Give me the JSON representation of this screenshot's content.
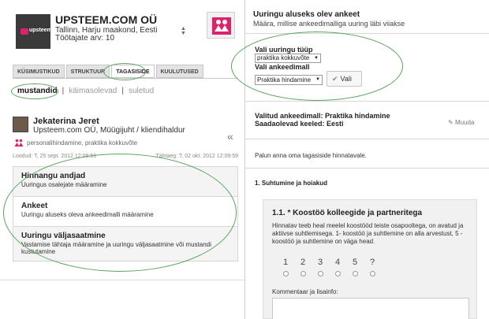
{
  "company": {
    "name": "UPSTEEM.COM OÜ",
    "location": "Tallinn, Harju maakond, Eesti",
    "employees": "Töötajate arv: 10",
    "logo_text": "upsteem"
  },
  "tabs": [
    {
      "label": "KÜSIMUSTIKUD"
    },
    {
      "label": "STRUKTUUR"
    },
    {
      "label": "TAGASISIDE"
    },
    {
      "label": "KUULUTUSED"
    }
  ],
  "filters": {
    "active": "mustandid",
    "ongoing": "käimasolevad",
    "closed": "suletud",
    "separator": "|"
  },
  "person": {
    "name": "Jekaterina Jeret",
    "org": "Upsteem.com OÜ, Müügijuht / kliendihaldur",
    "types": "personalihindamine, praktika kokkuvõte",
    "created": "Loodud: T, 25 sept. 2012 12:09:59",
    "due": "Tähtaeg: T, 02 okt. 2012 12:09:59"
  },
  "steps": [
    {
      "title": "Hinnangu andjad",
      "desc": "Uuringus osalejate määramine"
    },
    {
      "title": "Ankeet",
      "desc": "Uuringu aluseks oleva ankeedimalli määramine"
    },
    {
      "title": "Uuringu väljasaatmine",
      "desc": "Vastamise tähtaja määramine ja uuringu väljasaatmine või mustandi kustutamine"
    }
  ],
  "right": {
    "title": "Uuringu aluseks olev ankeet",
    "subtitle": "Määra, millise ankeedimalliga uuring läbi viiakse",
    "type_label": "Vali uuringu tüüp",
    "type_value": "praktika kokkuvõte",
    "template_label": "Vali ankeedimall",
    "template_value": "Praktika hindamine",
    "vali_button": "Vali",
    "selected_template": "Valitud ankeedimall: Praktika hindamine",
    "languages": "Saadaolevad keeled: Eesti",
    "muuda": "Muuda",
    "please": "Palun anna oma tagasiside hinnatavale.",
    "section_title": "1. Suhtumine ja hoiakud",
    "question": {
      "title": "1.1. * Koostöö kolleegide ja partneritega",
      "desc": "Hinnatav teeb heal meelel koostööd teiste osapooltega, on avatud ja aktiivse suhtlemisega. 1- koostöö ja suhtlemine on alla arvestust, 5 - koostöö ja suhtlemine on väga head.",
      "scale": [
        "1",
        "2",
        "3",
        "4",
        "5",
        "?"
      ],
      "comment_label": "Kommentaar ja lisainfo:"
    }
  },
  "colors": {
    "accent": "#e0206a",
    "highlight_ellipse": "#5aa55a"
  }
}
